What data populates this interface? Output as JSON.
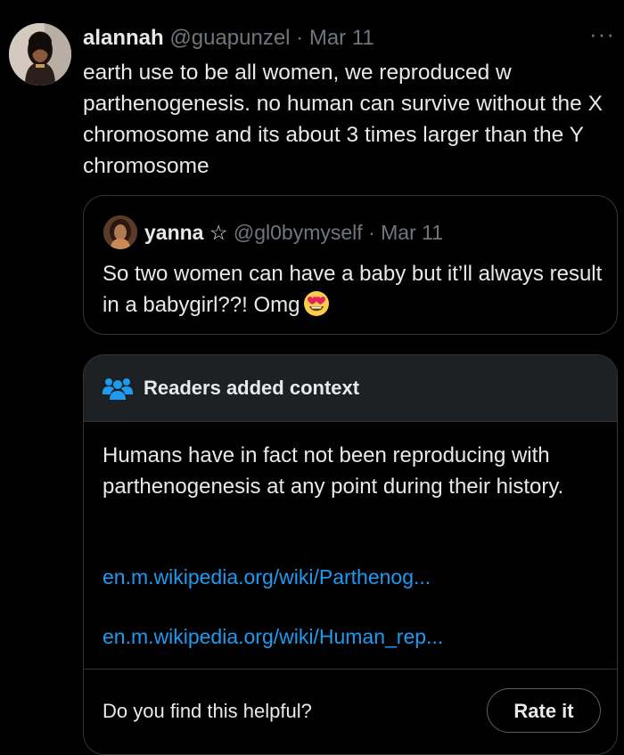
{
  "tweet": {
    "author_name": "alannah",
    "handle": "@guapunzel",
    "separator": " · ",
    "date": "Mar 11",
    "text": "earth use to be all women, we reproduced w parthenogenesis. no human can survive without the X chromosome and its about 3 times larger than the Y chromosome",
    "more_icon": "more-horizontal-icon",
    "more_glyph": "···"
  },
  "quote": {
    "author_name": "yanna",
    "name_symbol": "☆",
    "handle": "@gl0bymyself",
    "separator": " · ",
    "date": "Mar 11",
    "text": "So two women can have a baby but it’ll always result in a babygirl??! Omg",
    "emoji": "heart-eyes-emoji"
  },
  "community_note": {
    "title": "Readers added context",
    "icon": "people-icon",
    "body": "Humans have in fact not been reproducing with parthenogenesis at any point during their history.",
    "links": [
      "en.m.wikipedia.org/wiki/Parthenog...",
      "en.m.wikipedia.org/wiki/Human_rep..."
    ],
    "helpful_question": "Do you find this helpful?",
    "rate_button": "Rate it"
  },
  "colors": {
    "background": "#000000",
    "text": "#e7e9ea",
    "muted": "#71767b",
    "link": "#1d9bf0",
    "border": "#333639",
    "note_header": "#1e2124"
  }
}
